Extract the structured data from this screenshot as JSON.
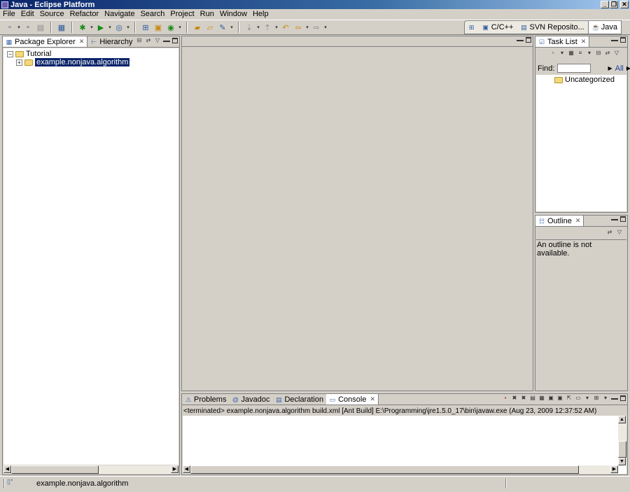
{
  "window": {
    "title": "Java - Eclipse Platform",
    "controls": [
      "_",
      "❐",
      "✕"
    ]
  },
  "menu": [
    "File",
    "Edit",
    "Source",
    "Refactor",
    "Navigate",
    "Search",
    "Project",
    "Run",
    "Window",
    "Help"
  ],
  "perspectives": [
    {
      "label": "C/C++",
      "icon": "cpp-perspective-icon",
      "active": false
    },
    {
      "label": "SVN Reposito...",
      "icon": "svn-perspective-icon",
      "active": false
    },
    {
      "label": "Java",
      "icon": "java-perspective-icon",
      "active": true
    }
  ],
  "left_panel": {
    "tabs": [
      {
        "label": "Package Explorer",
        "active": true
      },
      {
        "label": "Hierarchy",
        "active": false
      }
    ],
    "tree": [
      {
        "label": "Tutorial",
        "expander": "−",
        "depth": 0,
        "selected": false
      },
      {
        "label": "example.nonjava.algorithm",
        "expander": "+",
        "depth": 1,
        "selected": true
      }
    ]
  },
  "task_list": {
    "tab": "Task List",
    "find_label": "Find:",
    "find_value": "",
    "all_label": "All",
    "category": "Uncategorized"
  },
  "outline": {
    "tab": "Outline",
    "message": "An outline is not available."
  },
  "bottom_panel": {
    "tabs": [
      {
        "label": "Problems",
        "active": false
      },
      {
        "label": "Javadoc",
        "active": false
      },
      {
        "label": "Declaration",
        "active": false
      },
      {
        "label": "Console",
        "active": true
      }
    ],
    "console_header": "<terminated> example.nonjava.algorithm build.xml [Ant Build] E:\\Programming\\jre1.5.0_17\\bin\\javaw.exe (Aug 23, 2009 12:37:52 AM)"
  },
  "status_bar": {
    "selection": "example.nonjava.algorithm"
  }
}
